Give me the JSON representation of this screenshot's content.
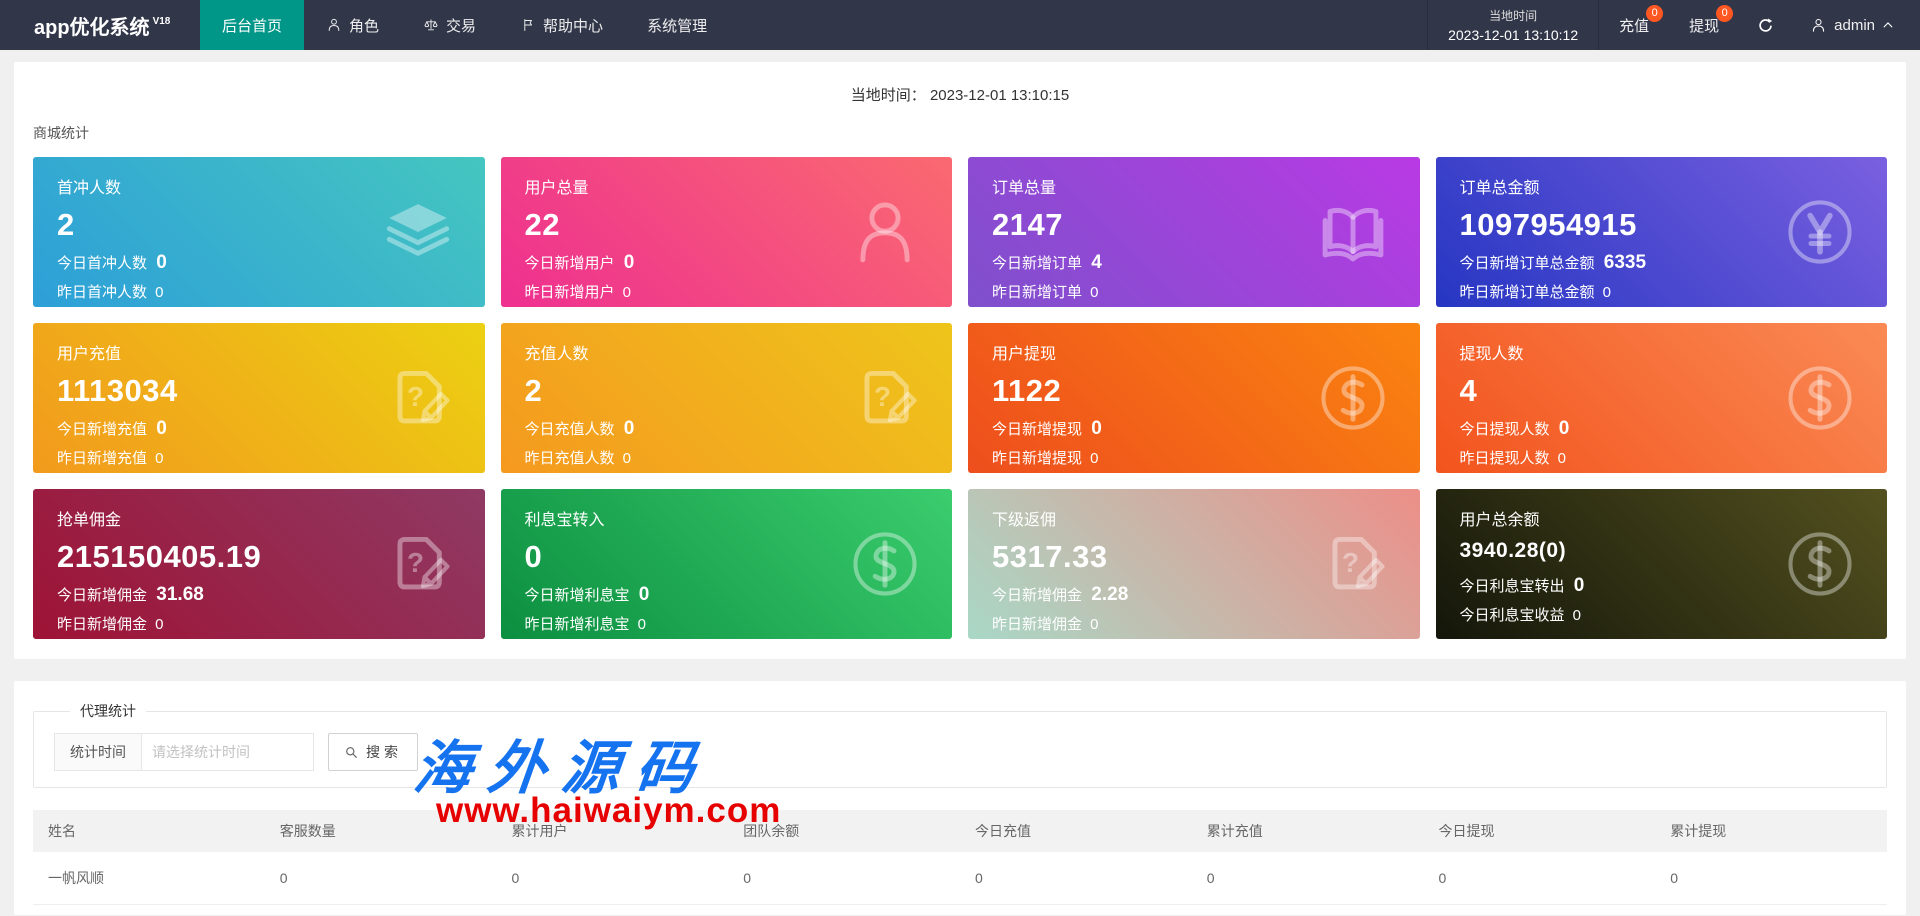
{
  "navbar": {
    "logo": "app优化系统",
    "logo_version": "V18",
    "active_bg": "#009688",
    "badge_color": "#ff5722",
    "menu": [
      {
        "id": "home",
        "label": "后台首页",
        "icon": null,
        "active": true
      },
      {
        "id": "role",
        "label": "角色",
        "icon": "user-icon",
        "active": false
      },
      {
        "id": "trade",
        "label": "交易",
        "icon": "scales-icon",
        "active": false
      },
      {
        "id": "help",
        "label": "帮助中心",
        "icon": "flag-icon",
        "active": false
      },
      {
        "id": "system",
        "label": "系统管理",
        "icon": null,
        "active": false
      }
    ],
    "local_time_label": "当地时间",
    "local_time_value": "2023-12-01 13:10:12",
    "recharge_label": "充值",
    "recharge_badge": "0",
    "withdraw_label": "提现",
    "withdraw_badge": "0",
    "username": "admin"
  },
  "overview": {
    "local_time_label": "当地时间：",
    "local_time_value": "2023-12-01 13:10:15",
    "section_title": "商城统计",
    "cards": [
      {
        "title": "首冲人数",
        "value": "2",
        "line2_label": "今日首冲人数",
        "line2_value": "0",
        "line3_label": "昨日首冲人数",
        "line3_value": "0",
        "icon": "layers-icon",
        "c1": "#2d9fd8",
        "c2": "#45c6c0",
        "small_value": false
      },
      {
        "title": "用户总量",
        "value": "22",
        "line2_label": "今日新增用户",
        "line2_value": "0",
        "line3_label": "昨日新增用户",
        "line3_value": "0",
        "icon": "person-icon",
        "c1": "#ee2f90",
        "c2": "#fa6a70",
        "small_value": false
      },
      {
        "title": "订单总量",
        "value": "2147",
        "line2_label": "今日新增订单",
        "line2_value": "4",
        "line3_label": "昨日新增订单",
        "line3_value": "0",
        "icon": "book-icon",
        "c1": "#7e50cc",
        "c2": "#b93ae4",
        "small_value": false
      },
      {
        "title": "订单总金额",
        "value": "1097954915",
        "line2_label": "今日新增订单总金额",
        "line2_value": "6335",
        "line3_label": "昨日新增订单总金额",
        "line3_value": "0",
        "icon": "yen-circle-icon",
        "c1": "#2636c2",
        "c2": "#7a60e0",
        "small_value": false
      },
      {
        "title": "用户充值",
        "value": "1113034",
        "line2_label": "今日新增充值",
        "line2_value": "0",
        "line3_label": "昨日新增充值",
        "line3_value": "0",
        "icon": "doc-edit-icon",
        "c1": "#f29a1d",
        "c2": "#ecd012",
        "small_value": false
      },
      {
        "title": "充值人数",
        "value": "2",
        "line2_label": "今日充值人数",
        "line2_value": "0",
        "line3_label": "昨日充值人数",
        "line3_value": "0",
        "icon": "doc-edit-icon",
        "c1": "#f5991f",
        "c2": "#eec51b",
        "small_value": false
      },
      {
        "title": "用户提现",
        "value": "1122",
        "line2_label": "今日新增提现",
        "line2_value": "0",
        "line3_label": "昨日新增提现",
        "line3_value": "0",
        "icon": "dollar-circle-icon",
        "c1": "#ee4e1d",
        "c2": "#fa8410",
        "small_value": false
      },
      {
        "title": "提现人数",
        "value": "4",
        "line2_label": "今日提现人数",
        "line2_value": "0",
        "line3_label": "昨日提现人数",
        "line3_value": "0",
        "icon": "dollar-circle-icon",
        "c1": "#f3541d",
        "c2": "#fa8a55",
        "small_value": false
      },
      {
        "title": "抢单佣金",
        "value": "215150405.19",
        "line2_label": "今日新增佣金",
        "line2_value": "31.68",
        "line3_label": "昨日新增佣金",
        "line3_value": "0",
        "icon": "doc-edit-icon",
        "c1": "#9e1335",
        "c2": "#8f3a64",
        "small_value": false
      },
      {
        "title": "利息宝转入",
        "value": "0",
        "line2_label": "今日新增利息宝",
        "line2_value": "0",
        "line3_label": "昨日新增利息宝",
        "line3_value": "0",
        "icon": "dollar-circle-icon",
        "c1": "#0c8f40",
        "c2": "#3bcd6e",
        "small_value": false
      },
      {
        "title": "下级返佣",
        "value": "5317.33",
        "line2_label": "今日新增佣金",
        "line2_value": "2.28",
        "line3_label": "昨日新增佣金",
        "line3_value": "0",
        "icon": "doc-edit-icon",
        "c1": "#a9d8c6",
        "c2": "#ec8f88",
        "small_value": false
      },
      {
        "title": "用户总余额",
        "value": "3940.28(0)",
        "line2_label": "今日利息宝转出",
        "line2_value": "0",
        "line3_label": "今日利息宝收益",
        "line3_value": "0",
        "icon": "dollar-circle-icon",
        "c1": "#14160a",
        "c2": "#53511f",
        "small_value": true
      }
    ]
  },
  "agent_section": {
    "legend": "代理统计",
    "time_label": "统计时间",
    "time_placeholder": "请选择统计时间",
    "search_label": "搜索",
    "table": {
      "columns": [
        "姓名",
        "客服数量",
        "累计用户",
        "团队余额",
        "今日充值",
        "累计充值",
        "今日提现",
        "累计提现"
      ],
      "rows": [
        [
          "一帆风顺",
          "0",
          "0",
          "0",
          "0",
          "0",
          "0",
          "0"
        ]
      ]
    }
  },
  "watermark": {
    "line1": "海外源码",
    "line2": "www.haiwaiym.com",
    "color1": "#1673f0",
    "color2": "#e60000"
  }
}
